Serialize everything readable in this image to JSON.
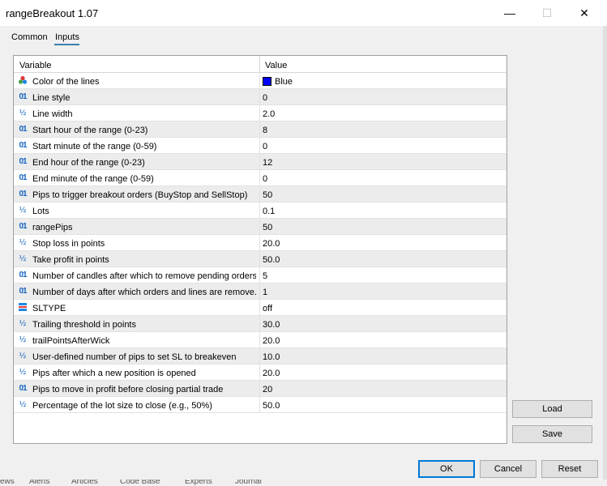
{
  "window": {
    "title": "rangeBreakout 1.07"
  },
  "tabs": [
    {
      "label": "Common"
    },
    {
      "label": "Inputs"
    }
  ],
  "grid": {
    "columns": {
      "variable": "Variable",
      "value": "Value"
    },
    "rows": [
      {
        "type": "color",
        "icon": "color-palette-icon",
        "name": "Color of the lines",
        "value": "Blue"
      },
      {
        "type": "int",
        "icon": "int-type-icon",
        "name": "Line style",
        "value": "0"
      },
      {
        "type": "double",
        "icon": "double-type-icon",
        "name": "Line width",
        "value": "2.0"
      },
      {
        "type": "int",
        "icon": "int-type-icon",
        "name": "Start hour of the range (0-23)",
        "value": "8"
      },
      {
        "type": "int",
        "icon": "int-type-icon",
        "name": "Start minute of the range (0-59)",
        "value": "0"
      },
      {
        "type": "int",
        "icon": "int-type-icon",
        "name": "End hour of the range (0-23)",
        "value": "12"
      },
      {
        "type": "int",
        "icon": "int-type-icon",
        "name": "End minute of the range (0-59)",
        "value": "0"
      },
      {
        "type": "int",
        "icon": "int-type-icon",
        "name": "Pips to trigger breakout orders (BuyStop and SellStop)",
        "value": "50"
      },
      {
        "type": "double",
        "icon": "double-type-icon",
        "name": "Lots",
        "value": "0.1"
      },
      {
        "type": "int",
        "icon": "int-type-icon",
        "name": "rangePips",
        "value": "50"
      },
      {
        "type": "double",
        "icon": "double-type-icon",
        "name": "Stop loss in points",
        "value": "20.0"
      },
      {
        "type": "double",
        "icon": "double-type-icon",
        "name": "Take profit in points",
        "value": "50.0"
      },
      {
        "type": "int",
        "icon": "int-type-icon",
        "name": "Number of candles after which to remove pending orders",
        "value": "5"
      },
      {
        "type": "int",
        "icon": "int-type-icon",
        "name": "Number of days after which orders and lines are remove...",
        "value": "1"
      },
      {
        "type": "enum",
        "icon": "enum-type-icon",
        "name": "SLTYPE",
        "value": "off"
      },
      {
        "type": "double",
        "icon": "double-type-icon",
        "name": "Trailing threshold in points",
        "value": "30.0"
      },
      {
        "type": "double",
        "icon": "double-type-icon",
        "name": "trailPointsAfterWick",
        "value": "20.0"
      },
      {
        "type": "double",
        "icon": "double-type-icon",
        "name": "User-defined number of pips to set SL to breakeven",
        "value": "10.0"
      },
      {
        "type": "double",
        "icon": "double-type-icon",
        "name": "Pips after which a new position is opened",
        "value": "20.0"
      },
      {
        "type": "int",
        "icon": "int-type-icon",
        "name": "Pips to move in profit before closing partial trade",
        "value": "20"
      },
      {
        "type": "double",
        "icon": "double-type-icon",
        "name": "Percentage of the lot size to close (e.g., 50%)",
        "value": "50.0"
      }
    ],
    "swatch_color": "#0000ff"
  },
  "side_buttons": {
    "load": "Load",
    "save": "Save"
  },
  "footer_buttons": {
    "ok": "OK",
    "cancel": "Cancel",
    "reset": "Reset"
  },
  "background_tabs": [
    "ews",
    "Alerts",
    "Articles",
    "Code Base",
    "Experts",
    "Journal"
  ],
  "icons": {
    "int": "01",
    "double": "½"
  }
}
